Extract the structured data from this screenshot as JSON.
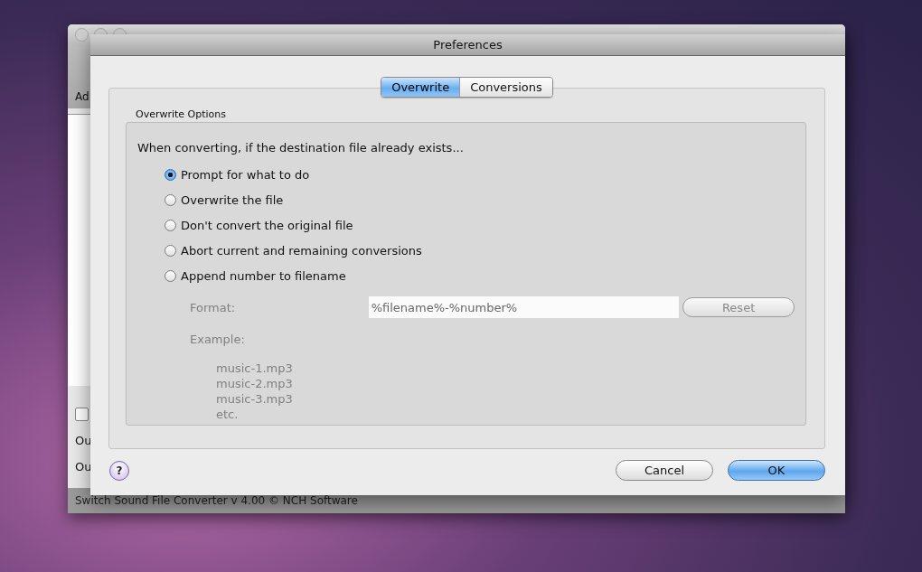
{
  "background_window": {
    "toolbar_label": "Ad",
    "checkbox": {
      "checked": false
    },
    "labels": [
      "Ou",
      "Ou"
    ],
    "status_bar": "Switch Sound File Converter v 4.00 © NCH Software"
  },
  "dialog": {
    "title": "Preferences",
    "tabs": [
      {
        "label": "Overwrite",
        "selected": true
      },
      {
        "label": "Conversions",
        "selected": false
      }
    ],
    "group": {
      "title": "Overwrite Options",
      "prompt": "When converting, if the destination file already exists...",
      "options": [
        {
          "label": "Prompt for what to do",
          "selected": true
        },
        {
          "label": "Overwrite the file",
          "selected": false
        },
        {
          "label": "Don't convert the original file",
          "selected": false
        },
        {
          "label": "Abort current and remaining conversions",
          "selected": false
        },
        {
          "label": "Append number to filename",
          "selected": false
        }
      ],
      "format": {
        "label": "Format:",
        "value": "%filename%-%number%",
        "disabled": true,
        "reset": "Reset"
      },
      "example": {
        "label": "Example:",
        "lines": [
          "music-1.mp3",
          "music-2.mp3",
          "music-3.mp3",
          "etc."
        ]
      }
    },
    "help": "?",
    "buttons": [
      {
        "label": "Cancel",
        "default": false
      },
      {
        "label": "OK",
        "default": true
      }
    ]
  }
}
